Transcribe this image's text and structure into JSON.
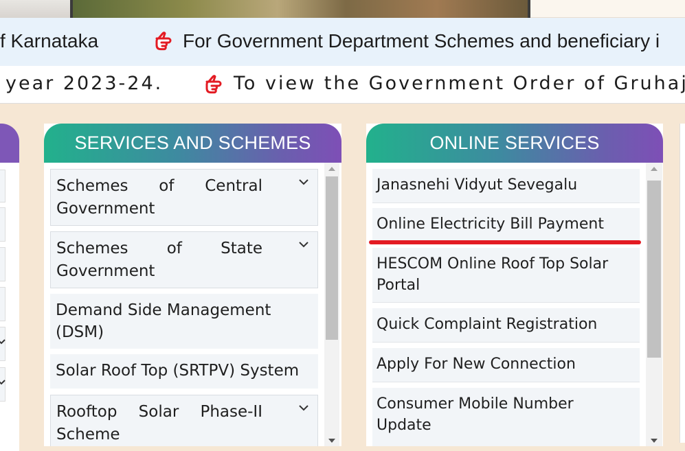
{
  "ticker": {
    "line1_part1": "f Karnataka",
    "line1_part2": "For Government Department Schemes and beneficiary i",
    "line2_part1": "year 2023-24.",
    "line2_part2": "To view the Government Order of Gruhajy"
  },
  "colors": {
    "hand_icon": "#e31b23",
    "header_gradient_start": "#22b18c",
    "header_gradient_end": "#7e4fb6",
    "highlight_underline": "#e31b23"
  },
  "services_and_schemes": {
    "title": "SERVICES AND SCHEMES",
    "items": [
      {
        "label": "Schemes of Central Government",
        "expandable": true
      },
      {
        "label": "Schemes of State Government",
        "expandable": true
      },
      {
        "label": "Demand Side Management (DSM)",
        "expandable": false
      },
      {
        "label": "Solar Roof Top (SRTPV) System",
        "expandable": false
      },
      {
        "label": "Rooftop Solar Phase-II Scheme",
        "expandable": true
      }
    ]
  },
  "online_services": {
    "title": "ONLINE SERVICES",
    "items": [
      {
        "label": "Janasnehi Vidyut Sevegalu"
      },
      {
        "label": "Online Electricity Bill Payment"
      },
      {
        "label": "HESCOM Online Roof Top Solar Portal"
      },
      {
        "label": "Quick Complaint Registration"
      },
      {
        "label": "Apply For New Connection"
      },
      {
        "label": "Consumer Mobile Number Update"
      }
    ]
  }
}
